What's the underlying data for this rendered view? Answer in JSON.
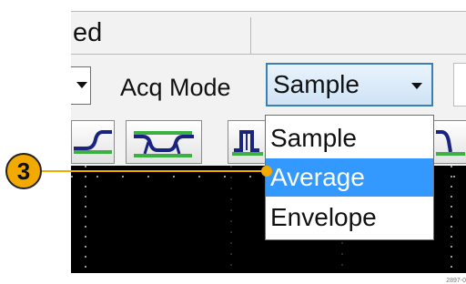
{
  "window": {
    "title_fragment": "ed"
  },
  "toolbar": {
    "acq_mode_label": "Acq Mode",
    "acq_mode_value": "Sample"
  },
  "dropdown": {
    "options": [
      {
        "label": "Sample",
        "selected": false
      },
      {
        "label": "Average",
        "selected": true
      },
      {
        "label": "Envelope",
        "selected": false
      }
    ]
  },
  "callout": {
    "number": "3"
  },
  "figure_id": "2897-0",
  "colors": {
    "highlight": "#3399ff",
    "callout": "#f2a900",
    "select_border": "#3c7fb1",
    "trigger_icon": "#1a237e",
    "trigger_level": "#3cb043"
  },
  "icons": [
    "rising-edge-icon",
    "pulse-both-icon",
    "positive-pulse-icon",
    "negative-pulse-icon"
  ]
}
